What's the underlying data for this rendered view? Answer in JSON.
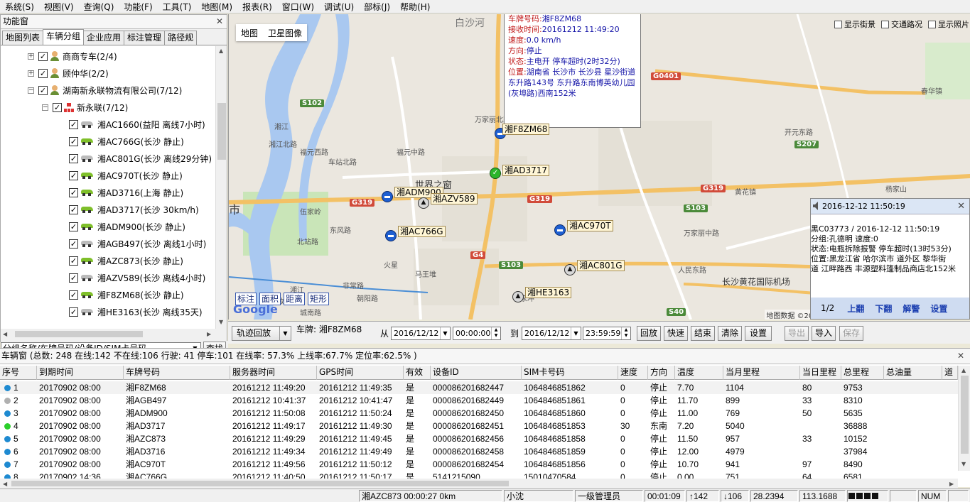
{
  "menu": [
    "系统(S)",
    "视图(V)",
    "查询(Q)",
    "功能(F)",
    "工具(T)",
    "地图(M)",
    "报表(R)",
    "窗口(W)",
    "调试(U)",
    "部标(J)",
    "帮助(H)"
  ],
  "left_panel": {
    "title": "功能窗",
    "tabs": [
      "地图列表",
      "车辆分组",
      "企业应用",
      "标注管理",
      "路径规"
    ],
    "active_tab": 1,
    "tree_groups": [
      {
        "label": "商商专车(2/4)"
      },
      {
        "label": "顾仲华(2/2)"
      },
      {
        "label": "湖南新永联物流有限公司(7/12)"
      }
    ],
    "subgroup": "新永联(7/12)",
    "vehicles": [
      {
        "label": "湘AC1660(益阳 离线7小时)",
        "online": false
      },
      {
        "label": "湘AC766G(长沙 静止)",
        "online": true
      },
      {
        "label": "湘AC801G(长沙 离线29分钟)",
        "online": false
      },
      {
        "label": "湘AC970T(长沙 静止)",
        "online": true
      },
      {
        "label": "湘AD3716(上海 静止)",
        "online": true
      },
      {
        "label": "湘AD3717(长沙 30km/h)",
        "online": true
      },
      {
        "label": "湘ADM900(长沙 静止)",
        "online": true
      },
      {
        "label": "湘AGB497(长沙 离线1小时)",
        "online": false
      },
      {
        "label": "湘AZC873(长沙 静止)",
        "online": true
      },
      {
        "label": "湘AZV589(长沙 离线4小时)",
        "online": false
      },
      {
        "label": "湘F8ZM68(长沙 静止)",
        "online": true
      },
      {
        "label": "湘HE3163(长沙 离线35天)",
        "online": false
      }
    ],
    "search_placeholder": "分组名称/车牌号码/设备ID/SIM卡号码",
    "search_button": "查找"
  },
  "map": {
    "types": [
      "地图",
      "卫星图像"
    ],
    "checks": [
      "显示街景",
      "交通路况",
      "显示照片"
    ],
    "info": {
      "lines": [
        {
          "k": "车牌号码:",
          "v": "湘F8ZM68"
        },
        {
          "k": "接收时间:",
          "v": "20161212 11:49:20"
        },
        {
          "k": "速度:",
          "v": "0.0 km/h"
        },
        {
          "k": "方向:",
          "v": "停止"
        },
        {
          "k": "状态:",
          "v": "主电开 停车超时(2时32分)"
        },
        {
          "k": "位置:",
          "v": "湖南省 长沙市 长沙县 星沙街道 东升路143号 东升路东南博英幼儿园(灰埠路)西南152米"
        }
      ]
    },
    "places": [
      "白沙河",
      "S102",
      "G0401",
      "S207",
      "G319",
      "G319",
      "G319",
      "S103",
      "S103",
      "G4",
      "S40",
      "世界之窗",
      "长沙黄花国际机场",
      "福元西路",
      "福元中路",
      "湘江北路",
      "万家丽北路",
      "开元东路",
      "浏城东路",
      "黄花镇",
      "人民东路",
      "杨家山",
      "马王堆",
      "火星",
      "东风路",
      "伍家岭",
      "北站路",
      "非常路",
      "湘江",
      "湘江",
      "市",
      "春华镇",
      "如意街",
      "朝阳路",
      "城南路",
      "蒋家冲",
      "车站北路",
      "万家丽中路"
    ],
    "markers": [
      {
        "name": "湘F8ZM68",
        "kind": "blue"
      },
      {
        "name": "湘AD3717",
        "kind": "green"
      },
      {
        "name": "湘ADM900",
        "kind": "blue"
      },
      {
        "name": "湘AZV589",
        "kind": "gray"
      },
      {
        "name": "湘AC766G",
        "kind": "blue"
      },
      {
        "name": "湘AC970T",
        "kind": "blue"
      },
      {
        "name": "湘AC801G",
        "kind": "gray"
      },
      {
        "name": "湘HE3163",
        "kind": "gray"
      }
    ],
    "tools": [
      "标注",
      "面积",
      "距离",
      "矩形"
    ],
    "logo": "Google",
    "copyright": "地图数据 ©2016"
  },
  "alarm": {
    "title": "2016-12-12 11:50:19",
    "lines": [
      "黑C03773 / 2016-12-12 11:50:19",
      "分组:孔德明 速度:0",
      "状态:电瓶拆除报警 停车超时(13时53分)",
      "位置:黑龙江省 哈尔滨市 道外区 黎华街",
      "道 江畔路西 丰源塑料篷制品商店北152米"
    ],
    "page": "1/2",
    "buttons": [
      "上翻",
      "下翻",
      "解警",
      "设置"
    ]
  },
  "playback": {
    "mode": "轨迹回放",
    "plate_label": "车牌: 湘F8ZM68",
    "from_label": "从",
    "from_date": "2016/12/12",
    "from_time": "00:00:00",
    "to_label": "到",
    "to_date": "2016/12/12",
    "to_time": "23:59:59",
    "buttons": [
      "回放",
      "快速",
      "结束",
      "清除",
      "设置"
    ],
    "right_buttons": [
      "导出",
      "导入",
      "保存"
    ]
  },
  "vehicle_window": {
    "title": "车辆窗  (总数: 248 在线:142 不在线:106 行驶: 41 停车:101  在线率: 57.3% 上线率:67.7% 定位率:62.5% )",
    "columns": [
      "序号",
      "到期时间",
      "车牌号码",
      "服务器时间",
      "GPS时间",
      "有效",
      "设备ID",
      "SIM卡号码",
      "速度",
      "方向",
      "温度",
      "当月里程",
      "当日里程",
      "总里程",
      "总油量",
      "道"
    ],
    "rows": [
      [
        "1",
        "20170902 08:00",
        "湘F8ZM68",
        "20161212 11:49:20",
        "20161212 11:49:35",
        "是",
        "000086201682447",
        "1064846851862",
        "0",
        "停止",
        "7.70",
        "1104",
        "80",
        "9753",
        ""
      ],
      [
        "2",
        "20170902 08:00",
        "湘AGB497",
        "20161212 10:41:37",
        "20161212 10:41:47",
        "是",
        "000086201682449",
        "1064846851861",
        "0",
        "停止",
        "11.70",
        "899",
        "33",
        "8310",
        ""
      ],
      [
        "3",
        "20170902 08:00",
        "湘ADM900",
        "20161212 11:50:08",
        "20161212 11:50:24",
        "是",
        "000086201682450",
        "1064846851860",
        "0",
        "停止",
        "11.00",
        "769",
        "50",
        "5635",
        ""
      ],
      [
        "4",
        "20170902 08:00",
        "湘AD3717",
        "20161212 11:49:17",
        "20161212 11:49:30",
        "是",
        "000086201682451",
        "1064846851853",
        "30",
        "东南",
        "7.20",
        "5040",
        "",
        "36888",
        ""
      ],
      [
        "5",
        "20170902 08:00",
        "湘AZC873",
        "20161212 11:49:29",
        "20161212 11:49:45",
        "是",
        "000086201682456",
        "1064846851858",
        "0",
        "停止",
        "11.50",
        "957",
        "33",
        "10152",
        ""
      ],
      [
        "6",
        "20170902 08:00",
        "湘AD3716",
        "20161212 11:49:34",
        "20161212 11:49:49",
        "是",
        "000086201682458",
        "1064846851859",
        "0",
        "停止",
        "12.00",
        "4979",
        "",
        "37984",
        ""
      ],
      [
        "7",
        "20170902 08:00",
        "湘AC970T",
        "20161212 11:49:56",
        "20161212 11:50:12",
        "是",
        "000086201682454",
        "1064846851856",
        "0",
        "停止",
        "10.70",
        "941",
        "97",
        "8490",
        ""
      ],
      [
        "8",
        "20170902 14:36",
        "湘AC766G",
        "20161212 11:40:50",
        "20161212 11:50:17",
        "是",
        "5141215090",
        "15010470584",
        "0",
        "停止",
        "0.00",
        "751",
        "64",
        "6581",
        ""
      ]
    ],
    "row_status": [
      "blue",
      "gray",
      "blue",
      "green",
      "blue",
      "blue",
      "blue",
      "blue"
    ]
  },
  "statusbar": [
    "湘AZC873 00:00:27  0km",
    "小沈",
    "一级管理员",
    "00:01:09",
    "↑142",
    "↓106",
    "28.2394",
    "113.1688",
    "NUM"
  ],
  "colors": {
    "online_car": "#7fbf2a",
    "offline_car": "#bbbbbb",
    "alarm_link": "#1c3fb0",
    "info_key": "#c01818",
    "info_value": "#1515a8"
  }
}
